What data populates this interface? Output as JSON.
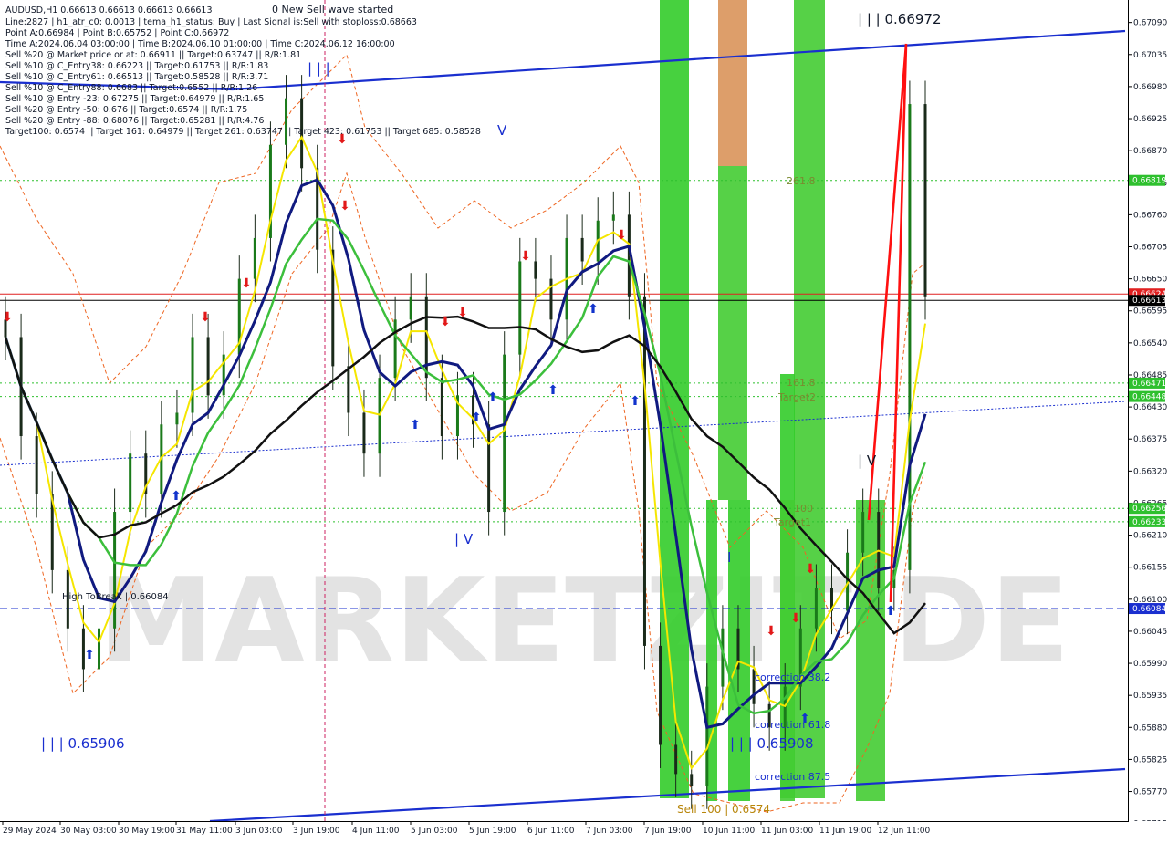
{
  "info_lines": [
    "AUDUSD,H1  0.66613 0.66613 0.66613 0.66613",
    "Line:2827  |  h1_atr_c0: 0.0013  |  tema_h1_status: Buy  |  Last Signal is:Sell with stoploss:0.68663",
    "Point A:0.66984  |  Point B:0.65752  |  Point C:0.66972",
    "Time A:2024.06.04 03:00:00  |  Time B:2024.06.10 01:00:00  |  Time C:2024.06.12 16:00:00",
    "Sell %20 @ Market price or at: 0.66911  ||  Target:0.63747  ||  R/R:1.81",
    "Sell %10 @ C_Entry38: 0.66223  ||  Target:0.61753  ||  R/R:1.83",
    "Sell %10 @ C_Entry61: 0.66513  ||  Target:0.58528  ||  R/R:3.71",
    "Sell %10 @ C_Entry88: 0.6683  ||  Target:0.6552  ||  R/R:1.26",
    "Sell %10 @ Entry -23: 0.67275  ||  Target:0.64979  ||  R/R:1.65",
    "Sell %20 @ Entry -50: 0.676  ||  Target:0.6574  ||  R/R:1.75",
    "Sell %20 @ Entry -88: 0.68076  ||  Target:0.65281  ||  R/R:4.76",
    "Target100: 0.6574  ||  Target 161: 0.64979  ||  Target 261: 0.63747  ||  Target 423: 0.61753  ||  Target 685: 0.58528"
  ],
  "wave_status": "0 New Sell wave started",
  "watermark": "MARKETZIT DE",
  "chart_labels": {
    "top_right_wave": "| | | 0.66972",
    "wave_I_top": "| | |",
    "wave_V": "V",
    "wave_IV": "| V",
    "wave_I_low": "I",
    "wave_IV_right": "| V",
    "bottom_left_wave": "| | | 0.65906",
    "bottom_mid_wave": "| | | 0.65908",
    "fib_261": "261.8",
    "fib_161": "161.8",
    "target2": "Target2",
    "fib_100": "100",
    "target1": "Target1",
    "corr_382": "correction 38.2",
    "corr_618": "correction 61.8",
    "corr_875": "correction 87.5",
    "sell_100": "Sell 100 | 0.6574",
    "high_to_break": "High ToBreak | 0.66084"
  },
  "chart_data": {
    "type": "candlestick",
    "symbol": "AUDUSD",
    "timeframe": "H1",
    "ylim": [
      0.65727,
      0.67102
    ],
    "y_ticks": [
      "0.67090",
      "0.67035",
      "0.66980",
      "0.66925",
      "0.66870",
      "0.66815",
      "0.66760",
      "0.66705",
      "0.66650",
      "0.66595",
      "0.66540",
      "0.66485",
      "0.66430",
      "0.66375",
      "0.66320",
      "0.66265",
      "0.66210",
      "0.66155",
      "0.66100",
      "0.66045",
      "0.65990",
      "0.65935",
      "0.65880",
      "0.65825",
      "0.65770",
      "0.65715"
    ],
    "x_ticks": [
      "29 May 2024",
      "30 May 03:00",
      "30 May 19:00",
      "31 May 11:00",
      "3 Jun 03:00",
      "3 Jun 19:00",
      "4 Jun 11:00",
      "5 Jun 03:00",
      "5 Jun 19:00",
      "6 Jun 11:00",
      "7 Jun 03:00",
      "7 Jun 19:00",
      "10 Jun 11:00",
      "11 Jun 03:00",
      "11 Jun 19:00",
      "12 Jun 11:00"
    ],
    "price_badges": [
      {
        "value": "0.66819",
        "color": "#2ec02e"
      },
      {
        "value": "0.66624",
        "color": "#e02020"
      },
      {
        "value": "0.66613",
        "color": "#000000"
      },
      {
        "value": "0.66471",
        "color": "#2ec02e"
      },
      {
        "value": "0.66448",
        "color": "#2ec02e"
      },
      {
        "value": "0.66256",
        "color": "#2ec02e"
      },
      {
        "value": "0.66233",
        "color": "#2ec02e"
      },
      {
        "value": "0.66084",
        "color": "#1a2fcf"
      }
    ],
    "series": [
      {
        "name": "close",
        "values": [
          0.6655,
          0.6638,
          0.6628,
          0.6615,
          0.6605,
          0.6598,
          0.6605,
          0.6625,
          0.6635,
          0.6628,
          0.664,
          0.6642,
          0.6655,
          0.6645,
          0.6652,
          0.6665,
          0.6672,
          0.6688,
          0.6696,
          0.6684,
          0.667,
          0.665,
          0.6642,
          0.6635,
          0.6648,
          0.6658,
          0.6662,
          0.6648,
          0.6638,
          0.6645,
          0.664,
          0.6625,
          0.6652,
          0.6668,
          0.6665,
          0.6658,
          0.6672,
          0.6668,
          0.6675,
          0.6676,
          0.6662,
          0.6602,
          0.6585,
          0.658,
          0.6578,
          0.6595,
          0.6605,
          0.6598,
          0.6592,
          0.6588,
          0.6595,
          0.6605,
          0.6612,
          0.6608,
          0.6618,
          0.6625,
          0.6612,
          0.6615,
          0.6695,
          0.6662
        ]
      }
    ]
  }
}
